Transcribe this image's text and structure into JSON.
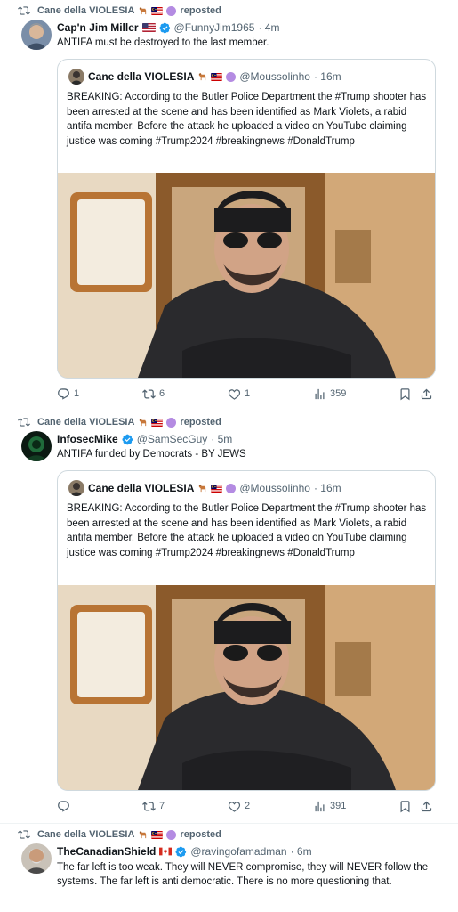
{
  "posts": [
    {
      "repost_label": "reposted",
      "reposter": "Cane della VIOLESIA",
      "author_name": "Cap'n Jim Miller",
      "author_handle": "@FunnyJim1965",
      "time": "· 4m",
      "text": "ANTIFA must be destroyed to the last member.",
      "quote": {
        "name": "Cane della VIOLESIA",
        "handle": "@Moussolinho",
        "time": "· 16m",
        "text": "BREAKING: According to the Butler Police Department the #Trump shooter has been arrested at the scene and has been identified as Mark Violets, a rabid antifa member. Before the attack he uploaded a video on YouTube claiming justice was coming #Trump2024 #breakingnews #DonaldTrump"
      },
      "stats": {
        "replies": "1",
        "reposts": "6",
        "likes": "1",
        "views": "359"
      }
    },
    {
      "repost_label": "reposted",
      "reposter": "Cane della VIOLESIA",
      "author_name": "InfosecMike",
      "author_handle": "@SamSecGuy",
      "time": "· 5m",
      "text": "ANTIFA funded by Democrats - BY JEWS",
      "quote": {
        "name": "Cane della VIOLESIA",
        "handle": "@Moussolinho",
        "time": "· 16m",
        "text": "BREAKING: According to the Butler Police Department the #Trump shooter has been arrested at the scene and has been identified as Mark Violets, a rabid antifa member. Before the attack he uploaded a video on YouTube claiming justice was coming #Trump2024 #breakingnews #DonaldTrump"
      },
      "stats": {
        "replies": "",
        "reposts": "7",
        "likes": "2",
        "views": "391"
      }
    },
    {
      "repost_label": "reposted",
      "reposter": "Cane della VIOLESIA",
      "author_name": "TheCanadianShield",
      "author_handle": "@ravingofamadman",
      "time": "· 6m",
      "text": "The far left is too weak. They will NEVER compromise, they will NEVER follow the systems. The far left is anti democratic. There is no more questioning that."
    }
  ],
  "colors": {
    "muted": "#536471",
    "verified": "#1d9bf0",
    "border": "#cfd9de",
    "text": "#0f1419"
  },
  "icons": [
    "repost-icon",
    "reply-icon",
    "like-icon",
    "views-icon",
    "bookmark-icon",
    "share-icon",
    "verified-badge-icon"
  ]
}
